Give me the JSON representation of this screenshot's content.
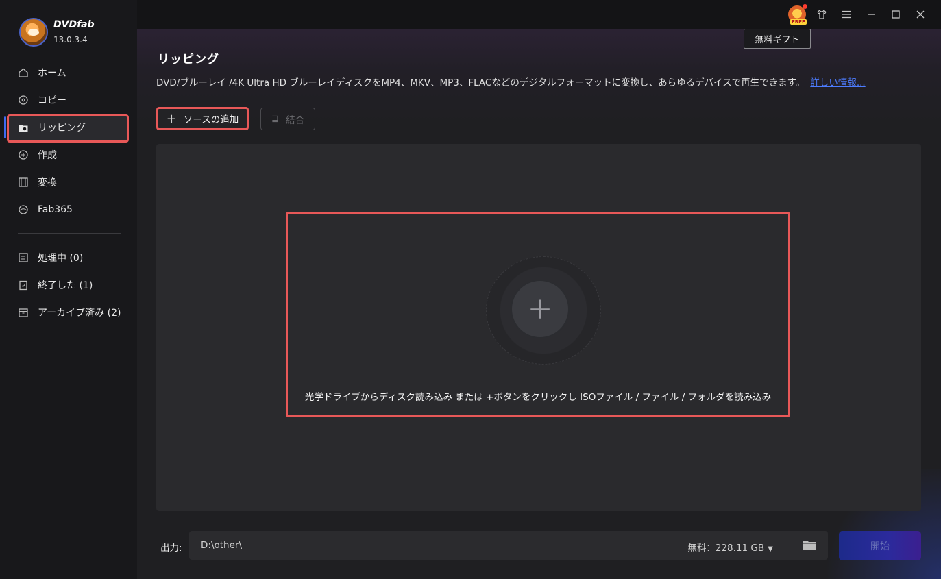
{
  "brand": {
    "name": "DVDfab",
    "version": "13.0.3.4"
  },
  "sidebar": {
    "items": [
      {
        "label": "ホーム",
        "icon": "home-icon"
      },
      {
        "label": "コピー",
        "icon": "copy-disc-icon"
      },
      {
        "label": "リッピング",
        "icon": "ripping-folder-icon",
        "active": true
      },
      {
        "label": "作成",
        "icon": "create-disc-icon"
      },
      {
        "label": "変換",
        "icon": "film-icon"
      },
      {
        "label": "Fab365",
        "icon": "fab365-icon"
      }
    ],
    "queue": [
      {
        "label": "処理中 (0)",
        "icon": "processing-list-icon"
      },
      {
        "label": "終了した (1)",
        "icon": "finished-clipboard-icon"
      },
      {
        "label": "アーカイブ済み (2)",
        "icon": "archive-box-icon"
      }
    ]
  },
  "topbar": {
    "tooltip": "無料ギフト",
    "free_badge": "FREE",
    "icons": [
      "gift-icon",
      "shirt-skin-icon",
      "menu-icon",
      "minimize-icon",
      "maximize-icon",
      "close-icon"
    ]
  },
  "main": {
    "title": "リッピング",
    "description": "DVD/ブルーレイ /4K Ultra HD ブルーレイディスクをMP4、MKV、MP3、FLACなどのデジタルフォーマットに変換し、あらゆるデバイスで再生できます。",
    "more_link": "詳しい情報...",
    "add_source": "ソースの追加",
    "merge": "結合",
    "drop_hint": "光学ドライブからディスク読み込み または +ボタンをクリックし ISOファイル / ファイル / フォルダを読み込み"
  },
  "output": {
    "label": "出力:",
    "path": "D:\\other\\",
    "free_space": "無料：228.11 GB",
    "start": "開始"
  },
  "colors": {
    "accent": "#3f6bf0",
    "highlight": "#e85858",
    "link": "#4d7cff"
  }
}
